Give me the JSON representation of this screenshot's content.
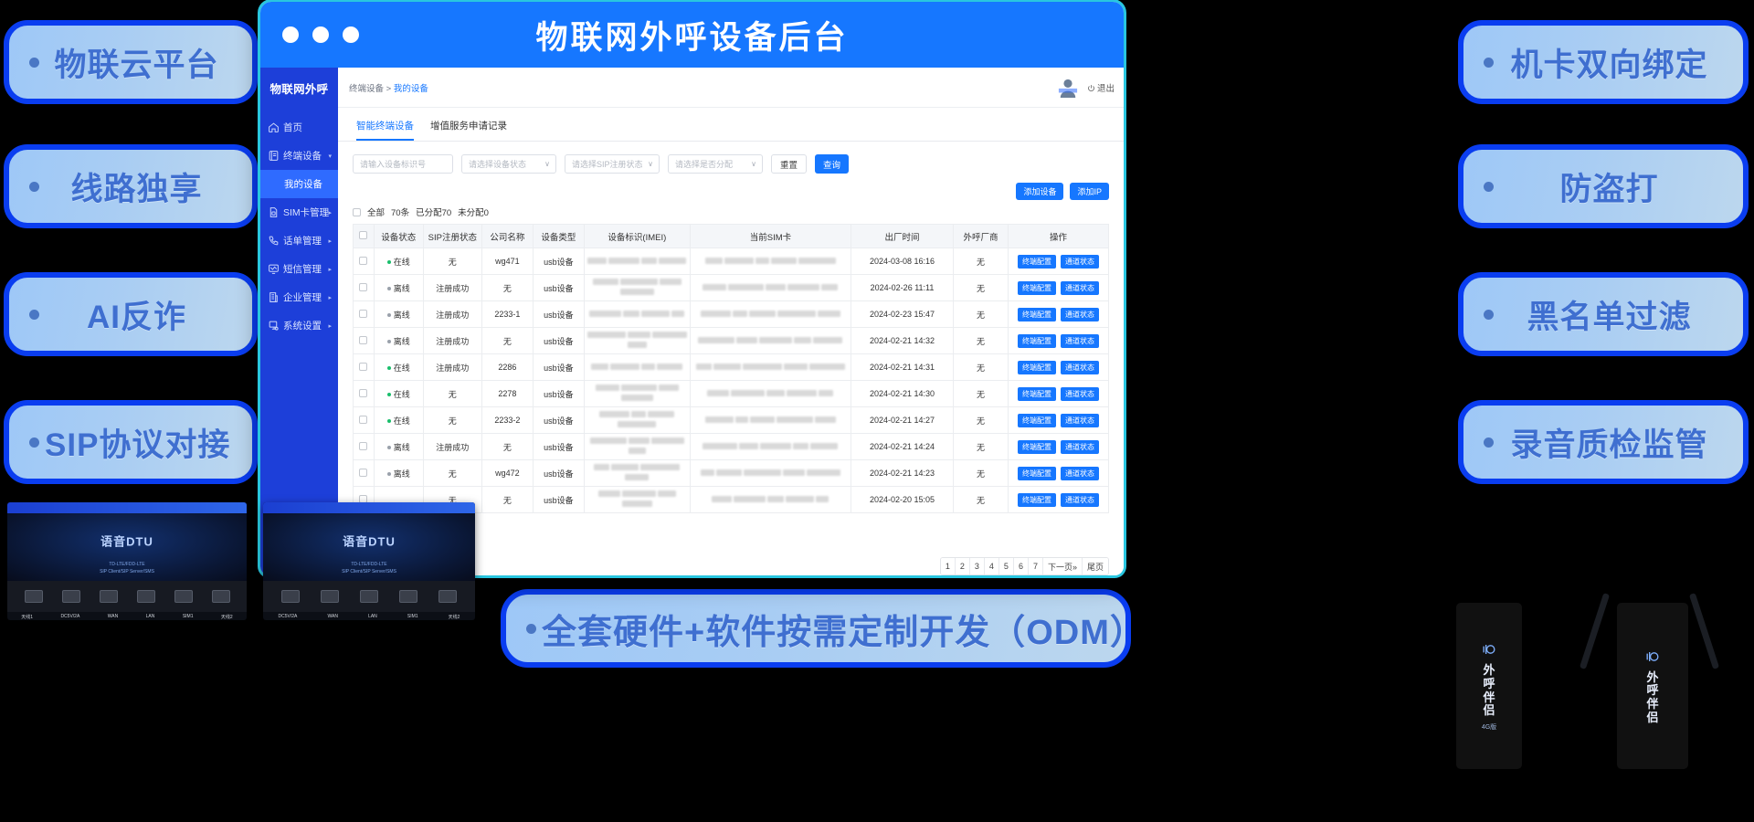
{
  "features_left": [
    {
      "label": "物联云平台"
    },
    {
      "label": "线路独享"
    },
    {
      "label": "AI反诈"
    },
    {
      "label": "SIP协议对接"
    }
  ],
  "features_right": [
    {
      "label": "机卡双向绑定"
    },
    {
      "label": "防盗打"
    },
    {
      "label": "黑名单过滤"
    },
    {
      "label": "录音质检监管"
    }
  ],
  "features_bottom": [
    {
      "label": "全套硬件+软件按需定制开发（ODM）"
    }
  ],
  "window": {
    "title": "物联网外呼设备后台",
    "accent": "#1677ff",
    "sidebar": {
      "logo": "物联网外呼",
      "items": [
        {
          "label": "首页",
          "icon": "home-icon",
          "arrow": "",
          "active": false,
          "sub": false
        },
        {
          "label": "终端设备",
          "icon": "device-icon",
          "arrow": "▾",
          "active": false,
          "sub": false
        },
        {
          "label": "我的设备",
          "icon": "",
          "arrow": "",
          "active": true,
          "sub": true
        },
        {
          "label": "SIM卡管理",
          "icon": "sim-icon",
          "arrow": "▸",
          "active": false,
          "sub": false
        },
        {
          "label": "话单管理",
          "icon": "phone-icon",
          "arrow": "▸",
          "active": false,
          "sub": false
        },
        {
          "label": "短信管理",
          "icon": "sms-icon",
          "arrow": "▸",
          "active": false,
          "sub": false
        },
        {
          "label": "企业管理",
          "icon": "company-icon",
          "arrow": "▸",
          "active": false,
          "sub": false
        },
        {
          "label": "系统设置",
          "icon": "gear-icon",
          "arrow": "▸",
          "active": false,
          "sub": false
        }
      ]
    },
    "topbar": {
      "breadcrumb_parent": "终端设备 > ",
      "breadcrumb_current": "我的设备",
      "logout": "退出",
      "avatar_icon": "user-avatar-icon",
      "power_icon": "power-icon"
    },
    "tabs": [
      {
        "label": "智能终端设备",
        "active": true
      },
      {
        "label": "增值服务申请记录",
        "active": false
      }
    ],
    "filters": {
      "device_id_placeholder": "请输入设备标识号",
      "device_status_placeholder": "请选择设备状态",
      "sip_status_placeholder": "请选择SIP注册状态",
      "assigned_placeholder": "请选择是否分配",
      "reset_label": "重置",
      "search_label": "查询",
      "caret": "∨"
    },
    "actions": {
      "add_device": "添加设备",
      "add_ip": "添加IP"
    },
    "summary": {
      "all_label": "全部",
      "total": "70条",
      "assigned": "已分配70",
      "unassigned": "未分配0"
    },
    "table": {
      "columns": [
        "",
        "设备状态",
        "SIP注册状态",
        "公司名称",
        "设备类型",
        "设备标识(IMEI)",
        "当前SIM卡",
        "出厂时间",
        "外呼厂商",
        "操作"
      ],
      "op_buttons": [
        "终端配置",
        "通道状态"
      ],
      "rows": [
        {
          "status": "在线",
          "online": true,
          "sip": "无",
          "company": "wg471",
          "type": "usb设备",
          "imei": "",
          "sim": "",
          "made": "2024-03-08 16:16",
          "vendor": "无"
        },
        {
          "status": "离线",
          "online": false,
          "sip": "注册成功",
          "company": "无",
          "type": "usb设备",
          "imei": "",
          "sim": "",
          "made": "2024-02-26 11:11",
          "vendor": "无"
        },
        {
          "status": "离线",
          "online": false,
          "sip": "注册成功",
          "company": "2233-1",
          "type": "usb设备",
          "imei": "",
          "sim": "",
          "made": "2024-02-23 15:47",
          "vendor": "无"
        },
        {
          "status": "离线",
          "online": false,
          "sip": "注册成功",
          "company": "无",
          "type": "usb设备",
          "imei": "",
          "sim": "",
          "made": "2024-02-21 14:32",
          "vendor": "无"
        },
        {
          "status": "在线",
          "online": true,
          "sip": "注册成功",
          "company": "2286",
          "type": "usb设备",
          "imei": "",
          "sim": "",
          "made": "2024-02-21 14:31",
          "vendor": "无"
        },
        {
          "status": "在线",
          "online": true,
          "sip": "无",
          "company": "2278",
          "type": "usb设备",
          "imei": "",
          "sim": "",
          "made": "2024-02-21 14:30",
          "vendor": "无"
        },
        {
          "status": "在线",
          "online": true,
          "sip": "无",
          "company": "2233-2",
          "type": "usb设备",
          "imei": "",
          "sim": "",
          "made": "2024-02-21 14:27",
          "vendor": "无"
        },
        {
          "status": "离线",
          "online": false,
          "sip": "注册成功",
          "company": "无",
          "type": "usb设备",
          "imei": "",
          "sim": "",
          "made": "2024-02-21 14:24",
          "vendor": "无"
        },
        {
          "status": "离线",
          "online": false,
          "sip": "无",
          "company": "wg472",
          "type": "usb设备",
          "imei": "",
          "sim": "",
          "made": "2024-02-21 14:23",
          "vendor": "无"
        },
        {
          "status": "",
          "online": false,
          "sip": "无",
          "company": "无",
          "type": "usb设备",
          "imei": "",
          "sim": "",
          "made": "2024-02-20 15:05",
          "vendor": "无"
        }
      ]
    },
    "pagination": [
      "1",
      "2",
      "3",
      "4",
      "5",
      "6",
      "7",
      "下一页»",
      "尾页"
    ]
  },
  "hardware": {
    "dtu_left": {
      "brand": "语音DTU",
      "sub": "TD-LTE/FDD-LTE\nSIP Client/SIP Server/SMS",
      "ports": [
        "天线1",
        "DC5V/2A",
        "WAN",
        "LAN",
        "SIM1",
        "天线2"
      ]
    },
    "dtu_right": {
      "brand": "语音DTU",
      "sub": "TD-LTE/FDD-LTE\nSIP Client/SIP Server/SMS",
      "ports": [
        "DC5V/2A",
        "WAN",
        "LAN",
        "SIM1",
        "天线2"
      ]
    },
    "dongle_left": {
      "brand": "外呼伴侣",
      "sub": "4G版"
    },
    "dongle_right": {
      "brand": "外呼伴侣",
      "sub": ""
    }
  }
}
